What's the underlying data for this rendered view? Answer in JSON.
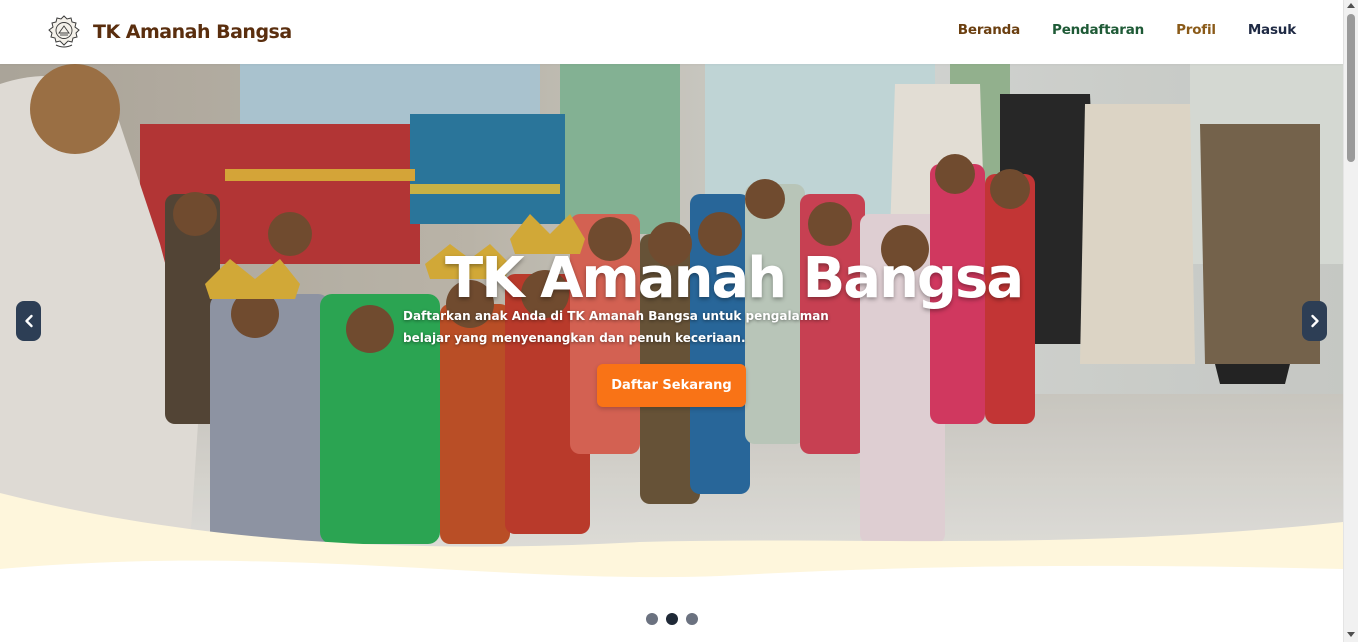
{
  "brand": {
    "name": "TK Amanah Bangsa",
    "logo_icon": "school-emblem-icon"
  },
  "nav": {
    "items": [
      {
        "label": "Beranda",
        "color": "#6b3f10"
      },
      {
        "label": "Pendaftaran",
        "color": "#1e5a36"
      },
      {
        "label": "Profil",
        "color": "#8a5a18"
      },
      {
        "label": "Masuk",
        "color": "#1f2a44"
      }
    ]
  },
  "hero": {
    "title": "TK Amanah Bangsa",
    "subtitle": "Daftarkan anak Anda di TK Amanah Bangsa untuk pengalaman belajar yang menyenangkan dan penuh keceriaan.",
    "cta_label": "Daftar Sekarang",
    "cta_color": "#f97316",
    "prev_icon": "chevron-left-icon",
    "next_icon": "chevron-right-icon",
    "slide_count": 3,
    "active_slide": 2
  },
  "colors": {
    "brand": "#5a2e0e",
    "wave": "#fef6dc"
  }
}
